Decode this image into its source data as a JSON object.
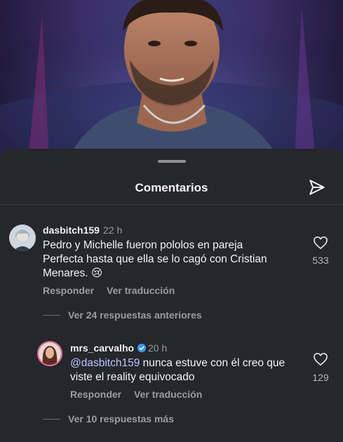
{
  "sheet": {
    "title": "Comentarios"
  },
  "comments": [
    {
      "username": "dasbitch159",
      "time": "22 h",
      "text_line1": "Pedro y Michelle fueron pololos en pareja",
      "text_line2": "Perfecta hasta que ella se lo cagó con Cristian",
      "text_line3": "Menares. 😢",
      "likes": "533",
      "reply_label": "Responder",
      "translate_label": "Ver traducción",
      "view_replies": "Ver 24 respuestas anteriores"
    },
    {
      "username": "mrs_carvalho",
      "time": "20 h",
      "mention": "@dasbitch159",
      "text_rest": " nunca estuve con él creo que",
      "text_line2": "viste el reality equivocado",
      "likes": "129",
      "reply_label": "Responder",
      "translate_label": "Ver traducción",
      "view_replies": "Ver 10 respuestas más"
    }
  ],
  "icons": {
    "send": "send-icon",
    "heart": "heart-icon",
    "verified": "verified-badge-icon"
  },
  "colors": {
    "sheet_bg": "#25272b",
    "mention": "#b9c7ff",
    "verified": "#3897f0"
  }
}
